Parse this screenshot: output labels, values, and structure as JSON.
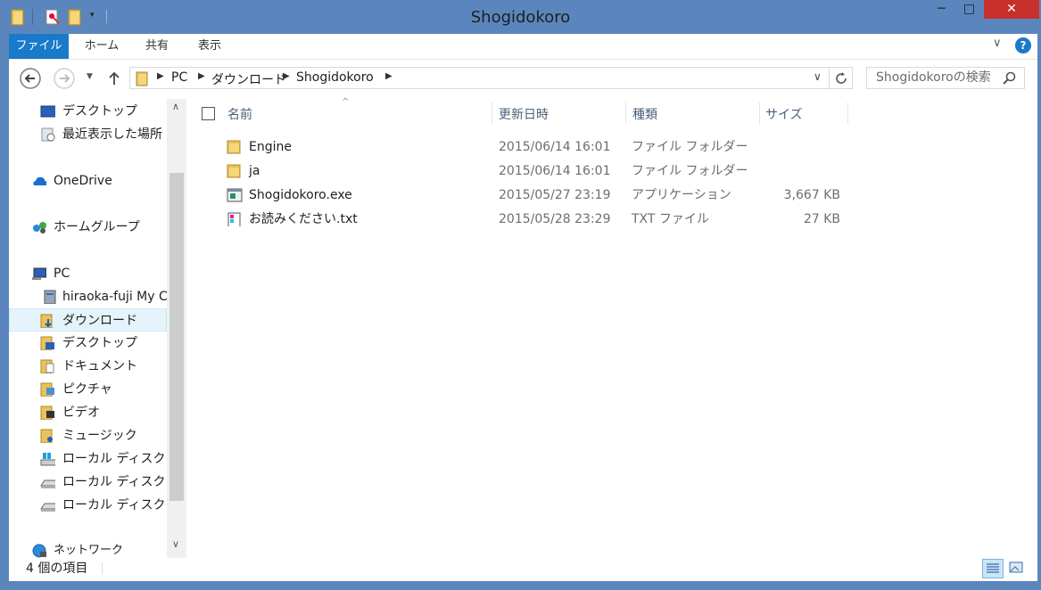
{
  "window": {
    "title": "Shogidokoro",
    "minimize": "─",
    "maximize": "□",
    "close": "✕"
  },
  "ribbon": {
    "tabs": [
      {
        "label": "ファイル"
      },
      {
        "label": "ホーム"
      },
      {
        "label": "共有"
      },
      {
        "label": "表示"
      }
    ]
  },
  "address": {
    "crumbs": [
      "PC",
      "ダウンロード",
      "Shogidokoro"
    ]
  },
  "search": {
    "placeholder": "Shogidokoroの検索"
  },
  "nav": {
    "items": [
      {
        "label": "デスクトップ",
        "icon": "desktop-icon"
      },
      {
        "label": "最近表示した場所",
        "icon": "recent-places-icon"
      },
      {
        "label": "OneDrive",
        "icon": "onedrive-icon"
      },
      {
        "label": "ホームグループ",
        "icon": "homegroup-icon"
      },
      {
        "label": "PC",
        "icon": "pc-icon"
      },
      {
        "label": "hiraoka-fuji My C",
        "icon": "network-drive-icon"
      },
      {
        "label": "ダウンロード",
        "icon": "downloads-folder-icon"
      },
      {
        "label": "デスクトップ",
        "icon": "desktop-folder-icon"
      },
      {
        "label": "ドキュメント",
        "icon": "documents-folder-icon"
      },
      {
        "label": "ピクチャ",
        "icon": "pictures-folder-icon"
      },
      {
        "label": "ビデオ",
        "icon": "videos-folder-icon"
      },
      {
        "label": "ミュージック",
        "icon": "music-folder-icon"
      },
      {
        "label": "ローカル ディスク (C",
        "icon": "local-disk-icon"
      },
      {
        "label": "ローカル ディスク (D",
        "icon": "disk-drive-icon"
      },
      {
        "label": "ローカル ディスク (F:",
        "icon": "disk-drive-icon"
      },
      {
        "label": "ネットワーク",
        "icon": "network-icon"
      }
    ]
  },
  "columns": {
    "name": "名前",
    "date": "更新日時",
    "type": "種類",
    "size": "サイズ"
  },
  "files": [
    {
      "name": "Engine",
      "date": "2015/06/14 16:01",
      "type": "ファイル フォルダー",
      "size": "",
      "icon": "folder-icon"
    },
    {
      "name": "ja",
      "date": "2015/06/14 16:01",
      "type": "ファイル フォルダー",
      "size": "",
      "icon": "folder-icon"
    },
    {
      "name": "Shogidokoro.exe",
      "date": "2015/05/27 23:19",
      "type": "アプリケーション",
      "size": "3,667 KB",
      "icon": "application-icon"
    },
    {
      "name": "お読みください.txt",
      "date": "2015/05/28 23:29",
      "type": "TXT ファイル",
      "size": "27 KB",
      "icon": "text-file-icon"
    }
  ],
  "status": {
    "item_count": "4 個の項目"
  },
  "colors": {
    "accent": "#1979ca",
    "frame": "#5b86bd",
    "close": "#c7302b"
  }
}
